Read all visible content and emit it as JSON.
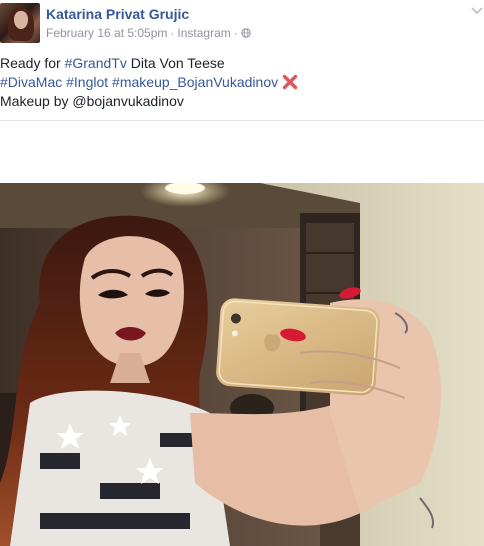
{
  "post": {
    "author": "Katarina Privat Grujic",
    "timestamp": "February 16 at 5:05pm",
    "separator": "·",
    "source": "Instagram",
    "line1_prefix": "Ready for ",
    "line1_tag": "#GrandTv",
    "line1_suffix": " Dita Von Teese",
    "line2_tags": "#DivaMac #Inglot #makeup_BojanVukadinov",
    "line3": "Makeup by @bojanvukadinov"
  },
  "icons": {
    "privacy": "globe-icon",
    "menu": "chevron-down-icon",
    "emoji": "cross-mark-emoji"
  },
  "colors": {
    "link": "#365899",
    "meta": "#90949c",
    "text": "#1d2129"
  }
}
